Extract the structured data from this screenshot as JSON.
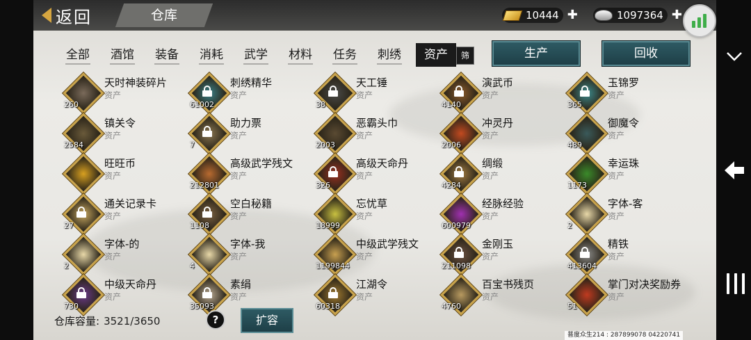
{
  "header": {
    "back_label": "返回",
    "title": "仓库",
    "gold": "10444",
    "silver": "1097364"
  },
  "categories": [
    "全部",
    "酒馆",
    "装备",
    "消耗",
    "武学",
    "材料",
    "任务",
    "刺绣"
  ],
  "active_category": "资产",
  "filter_label": "筛",
  "actions": {
    "produce": "生产",
    "recycle": "回收"
  },
  "items": [
    {
      "name": "天时神装碎片",
      "type": "资产",
      "count": "260",
      "color": "#7a6a5a",
      "locked": false
    },
    {
      "name": "刺绣精华",
      "type": "资产",
      "count": "61002",
      "color": "#3a7f85",
      "locked": true
    },
    {
      "name": "天工锤",
      "type": "资产",
      "count": "38",
      "color": "#4a4a48",
      "locked": true
    },
    {
      "name": "演武币",
      "type": "资产",
      "count": "4140",
      "color": "#8a5a2a",
      "locked": true
    },
    {
      "name": "玉锦罗",
      "type": "资产",
      "count": "365",
      "color": "#3c8a8c",
      "locked": true
    },
    {
      "name": "镇关令",
      "type": "资产",
      "count": "2584",
      "color": "#6a5a3a",
      "locked": false
    },
    {
      "name": "助力票",
      "type": "资产",
      "count": "7",
      "color": "#8a7650",
      "locked": true
    },
    {
      "name": "恶霸头巾",
      "type": "资产",
      "count": "2003",
      "color": "#5a4a32",
      "locked": false
    },
    {
      "name": "冲灵丹",
      "type": "资产",
      "count": "2006",
      "color": "#c24a20",
      "locked": false
    },
    {
      "name": "御魔令",
      "type": "资产",
      "count": "489",
      "color": "#3a5a5a",
      "locked": false
    },
    {
      "name": "旺旺币",
      "type": "资产",
      "count": "",
      "color": "#d8a020",
      "locked": false
    },
    {
      "name": "高级武学残文",
      "type": "资产",
      "count": "212801",
      "color": "#b86a30",
      "locked": false
    },
    {
      "name": "高级天命丹",
      "type": "资产",
      "count": "326",
      "color": "#9a3020",
      "locked": true
    },
    {
      "name": "绸缎",
      "type": "资产",
      "count": "4284",
      "color": "#a07a40",
      "locked": true
    },
    {
      "name": "幸运珠",
      "type": "资产",
      "count": "1173",
      "color": "#3a8a2a",
      "locked": false
    },
    {
      "name": "通关记录卡",
      "type": "资产",
      "count": "27",
      "color": "#c8a860",
      "locked": true
    },
    {
      "name": "空白秘籍",
      "type": "资产",
      "count": "1108",
      "color": "#7a6040",
      "locked": true
    },
    {
      "name": "忘忧草",
      "type": "资产",
      "count": "18999",
      "color": "#c8c040",
      "locked": false
    },
    {
      "name": "经脉经验",
      "type": "资产",
      "count": "600979",
      "color": "#a030b0",
      "locked": false
    },
    {
      "name": "字体-客",
      "type": "资产",
      "count": "2",
      "color": "#e8d8a8",
      "locked": false
    },
    {
      "name": "字体-的",
      "type": "资产",
      "count": "2",
      "color": "#e8d8a8",
      "locked": false
    },
    {
      "name": "字体-我",
      "type": "资产",
      "count": "4",
      "color": "#e8d8a8",
      "locked": false
    },
    {
      "name": "中级武学残文",
      "type": "资产",
      "count": "1199844",
      "color": "#c8a050",
      "locked": false
    },
    {
      "name": "金刚玉",
      "type": "资产",
      "count": "211098",
      "color": "#6a5040",
      "locked": true
    },
    {
      "name": "精铁",
      "type": "资产",
      "count": "413604",
      "color": "#8a8a88",
      "locked": true
    },
    {
      "name": "中级天命丹",
      "type": "资产",
      "count": "730",
      "color": "#6a3a8a",
      "locked": true
    },
    {
      "name": "素绢",
      "type": "资产",
      "count": "35093",
      "color": "#b8a890",
      "locked": true
    },
    {
      "name": "江湖令",
      "type": "资产",
      "count": "60318",
      "color": "#a07a30",
      "locked": true
    },
    {
      "name": "百宝书残页",
      "type": "资产",
      "count": "4760",
      "color": "#b89a60",
      "locked": false
    },
    {
      "name": "掌门对决奖励券",
      "type": "资产",
      "count": "51",
      "color": "#c03a20",
      "locked": false
    }
  ],
  "footer": {
    "capacity_label": "仓库容量:",
    "capacity_value": "3521/3650",
    "help_label": "?",
    "expand_label": "扩容",
    "server_info": "普度众生214 : 287899078  04220741"
  },
  "icons": [
    "back-arrow-icon",
    "gold-ingot-icon",
    "silver-ingot-icon",
    "plus-icon",
    "signal-icon",
    "chevron-down-icon",
    "back-nav-icon",
    "menu-nav-icon",
    "lock-icon"
  ]
}
